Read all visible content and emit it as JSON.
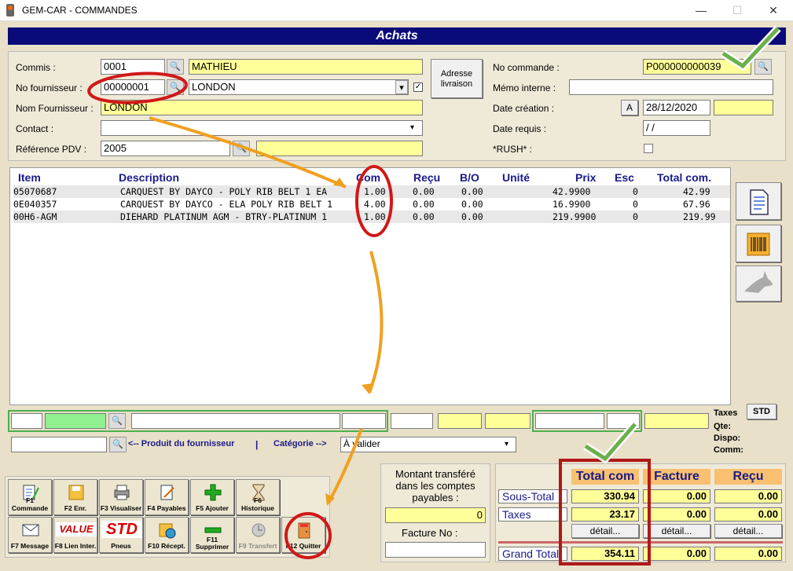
{
  "window": {
    "title": "GEM-CAR - COMMANDES"
  },
  "header": {
    "title": "Achats"
  },
  "form": {
    "commis_label": "Commis :",
    "commis_code": "0001",
    "commis_name": "MATHIEU",
    "fournisseur_label": "No fournisseur :",
    "fournisseur_code": "00000001",
    "fournisseur_name": "LONDON",
    "nom_label": "Nom Fournisseur :",
    "nom_value": "LONDON",
    "contact_label": "Contact :",
    "contact_value": "",
    "ref_label": "Référence PDV :",
    "ref_value": "2005",
    "ref_extra": "",
    "adresse_label": "Adresse livraison",
    "no_commande_label": "No commande :",
    "no_commande_value": "P000000000039",
    "memo_label": "Mémo interne :",
    "memo_value": "",
    "date_creation_label": "Date création :",
    "date_a_button": "A",
    "date_creation_value": "28/12/2020",
    "date_requis_label": "Date requis :",
    "date_requis_value": " / /",
    "rush_label": "*RUSH* :"
  },
  "grid": {
    "headers": [
      "Item",
      "Description",
      "Com",
      "Reçu",
      "B/O",
      "Unité",
      "Prix",
      "Esc",
      "Total com."
    ],
    "rows": [
      {
        "item": "05070687",
        "desc": "CARQUEST BY DAYCO - POLY RIB BELT 1 EA",
        "com": "1.00",
        "recu": "0.00",
        "bo": "0.00",
        "unite": "",
        "prix": "42.9900",
        "esc": "0",
        "total": "42.99"
      },
      {
        "item": "0E040357",
        "desc": "CARQUEST BY DAYCO - ELA POLY RIB BELT 1",
        "com": "4.00",
        "recu": "0.00",
        "bo": "0.00",
        "unite": "",
        "prix": "16.9900",
        "esc": "0",
        "total": "67.96"
      },
      {
        "item": "00H6-AGM",
        "desc": "DIEHARD PLATINUM AGM - BTRY-PLATINUM 1",
        "com": "1.00",
        "recu": "0.00",
        "bo": "0.00",
        "unite": "",
        "prix": "219.9900",
        "esc": "0",
        "total": "219.99"
      }
    ]
  },
  "entry": {
    "taxes_label": "Taxes",
    "std_button": "STD",
    "qte_label": "Qte:",
    "dispo_label": "Dispo:",
    "comm_label": "Comm:",
    "produit_link": "<-- Produit du fournisseur",
    "sep": "|",
    "categorie_link": "Catégorie -->",
    "categorie_value": "À valider"
  },
  "transfer": {
    "label": "Montant transféré dans les comptes payables :",
    "value": "0",
    "facture_label": "Facture No :",
    "facture_value": ""
  },
  "totals": {
    "headers": [
      "Total com",
      "Facture",
      "Reçu"
    ],
    "sous_total_label": "Sous-Total",
    "sous_total": [
      "330.94",
      "0.00",
      "0.00"
    ],
    "taxes_label": "Taxes",
    "taxes": [
      "23.17",
      "0.00",
      "0.00"
    ],
    "detail_label": "détail...",
    "grand_total_label": "Grand Total",
    "grand_total": [
      "354.11",
      "0.00",
      "0.00"
    ]
  },
  "toolbar": [
    {
      "label": "F1 Commande"
    },
    {
      "label": "F2 Enr."
    },
    {
      "label": "F3 Visualiser"
    },
    {
      "label": "F4 Payables"
    },
    {
      "label": "F5 Ajouter"
    },
    {
      "label": "F6 Historique"
    },
    {
      "label": "F7 Message"
    },
    {
      "label": "F8 Lien Inter."
    },
    {
      "label": "Pneus"
    },
    {
      "label": "F10 Récept."
    },
    {
      "label": "F11 Supprimer"
    },
    {
      "label": "F9 Transfert"
    },
    {
      "label": "F12 Quitter"
    }
  ],
  "logos": {
    "value": "VALUE",
    "std": "STD"
  }
}
